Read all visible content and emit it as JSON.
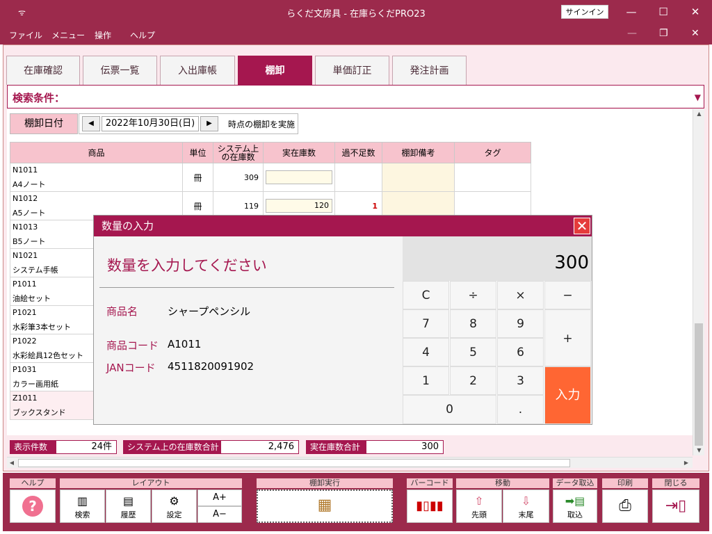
{
  "window": {
    "title": "らくだ文房具 - 在庫らくだPRO23",
    "signin_label": "サインイン",
    "minimize": "—",
    "maximize": "☐",
    "close": "✕",
    "sys_icon": "ᯤ"
  },
  "menu": {
    "items": [
      "ファイル",
      "メニュー",
      "操作",
      "ヘルプ"
    ],
    "mdi_minimize": "—",
    "mdi_restore": "❐",
    "mdi_close": "✕"
  },
  "tabs": [
    "在庫確認",
    "伝票一覧",
    "入出庫帳",
    "棚卸",
    "単価訂正",
    "発注計画"
  ],
  "search": {
    "label": "検索条件：",
    "caret": "▼"
  },
  "date_bar": {
    "label": "棚卸日付",
    "prev": "◀",
    "date": "2022年10月30日(日)",
    "next": "▶",
    "note": "時点の棚卸を実施"
  },
  "table": {
    "headers": {
      "product": "商品",
      "unit": "単位",
      "system_stock_1": "システム上",
      "system_stock_2": "の在庫数",
      "actual_stock": "実在庫数",
      "diff": "過不足数",
      "remark": "棚卸備考",
      "tag": "タグ"
    },
    "rows": [
      {
        "code": "N1011",
        "name": "A4ノート",
        "unit": "冊",
        "system": "309",
        "actual": "",
        "diff": ""
      },
      {
        "code": "N1012",
        "name": "A5ノート",
        "unit": "冊",
        "system": "119",
        "actual": "120",
        "diff": "1"
      },
      {
        "code": "N1013",
        "name": "B5ノート"
      },
      {
        "code": "N1021",
        "name": "システム手帳"
      },
      {
        "code": "P1011",
        "name": "油絵セット"
      },
      {
        "code": "P1021",
        "name": "水彩筆3本セット"
      },
      {
        "code": "P1022",
        "name": "水彩絵具12色セット"
      },
      {
        "code": "P1031",
        "name": "カラー画用紙"
      },
      {
        "code": "Z1011",
        "name": "ブックスタンド"
      }
    ]
  },
  "summary": {
    "count_label": "表示件数",
    "count_value": "24件",
    "system_total_label": "システム上の在庫数合計",
    "system_total_value": "2,476",
    "actual_total_label": "実在庫数合計",
    "actual_total_value": "300"
  },
  "dialog": {
    "title": "数量の入力",
    "close": "✕",
    "prompt": "数量を入力してください",
    "product_name_label": "商品名",
    "product_name_value": "シャープペンシル",
    "product_code_label": "商品コード",
    "product_code_value": "A1011",
    "jan_label": "JANコード",
    "jan_value": "4511820091902",
    "display_value": "300",
    "keys": {
      "clear": "C",
      "divide": "÷",
      "multiply": "×",
      "minus": "−",
      "k7": "7",
      "k8": "8",
      "k9": "9",
      "plus": "+",
      "k4": "4",
      "k5": "5",
      "k6": "6",
      "k1": "1",
      "k2": "2",
      "k3": "3",
      "enter": "入力",
      "k0": "0",
      "dot": "."
    }
  },
  "toolbar": {
    "help": {
      "header": "ヘルプ",
      "icon": "?"
    },
    "layout": {
      "header": "レイアウト",
      "search": "検索",
      "history": "履歴",
      "settings": "設定",
      "font_up": "A+",
      "font_down": "A−"
    },
    "inventory": {
      "header": "棚卸実行"
    },
    "barcode": {
      "header": "バーコード"
    },
    "move": {
      "header": "移動",
      "first": "先頭",
      "last": "末尾"
    },
    "import": {
      "header": "データ取込",
      "label": "取込"
    },
    "print": {
      "header": "印刷"
    },
    "close": {
      "header": "閉じる"
    }
  },
  "colors": {
    "accent": "#a5174f",
    "titlebar": "#9c2a4c",
    "header_pink": "#f7c3cd",
    "enter_key": "#ff6633"
  }
}
